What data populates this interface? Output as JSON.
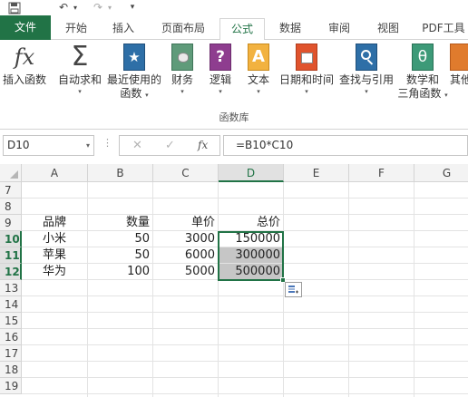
{
  "quick_access": {
    "undo_arrow": "↶",
    "redo_arrow": "↷",
    "customize": "▾"
  },
  "tabs": [
    {
      "label": "文件"
    },
    {
      "label": "开始"
    },
    {
      "label": "插入"
    },
    {
      "label": "页面布局"
    },
    {
      "label": "公式"
    },
    {
      "label": "数据"
    },
    {
      "label": "审阅"
    },
    {
      "label": "视图"
    },
    {
      "label": "PDF工具"
    }
  ],
  "ribbon": {
    "insert_function": {
      "label": "插入函数",
      "glyph": "fx"
    },
    "autosum": {
      "label": "自动求和",
      "glyph": "Σ"
    },
    "recent": {
      "label1": "最近使用的",
      "label2": "函数",
      "glyph": "★"
    },
    "financial": {
      "label": "财务"
    },
    "logical": {
      "label": "逻辑",
      "glyph": "?"
    },
    "text": {
      "label": "文本",
      "glyph": "A"
    },
    "datetime": {
      "label": "日期和时间"
    },
    "lookup": {
      "label": "查找与引用"
    },
    "math": {
      "label1": "数学和",
      "label2": "三角函数",
      "glyph": "θ"
    },
    "more": {
      "label": "其他"
    },
    "group_label": "函数库",
    "dropdown": "▾"
  },
  "formula_bar": {
    "name_box": "D10",
    "formula": "=B10*C10",
    "cancel": "✕",
    "enter": "✓",
    "fx": "fx",
    "separator": "⋮",
    "dropdown": "▾"
  },
  "columns": [
    "A",
    "B",
    "C",
    "D",
    "E",
    "F",
    "G"
  ],
  "rows": [
    "7",
    "8",
    "9",
    "10",
    "11",
    "12",
    "13",
    "14",
    "15",
    "16",
    "17",
    "18",
    "19"
  ],
  "table": {
    "header": {
      "brand": "品牌",
      "qty": "数量",
      "price": "单价",
      "total": "总价"
    },
    "data": [
      {
        "brand": "小米",
        "qty": "50",
        "price": "3000",
        "total": "150000"
      },
      {
        "brand": "苹果",
        "qty": "50",
        "price": "6000",
        "total": "300000"
      },
      {
        "brand": "华为",
        "qty": "100",
        "price": "5000",
        "total": "500000"
      }
    ]
  },
  "colors": {
    "accent": "#217346",
    "selection": "#c6c6c6"
  }
}
